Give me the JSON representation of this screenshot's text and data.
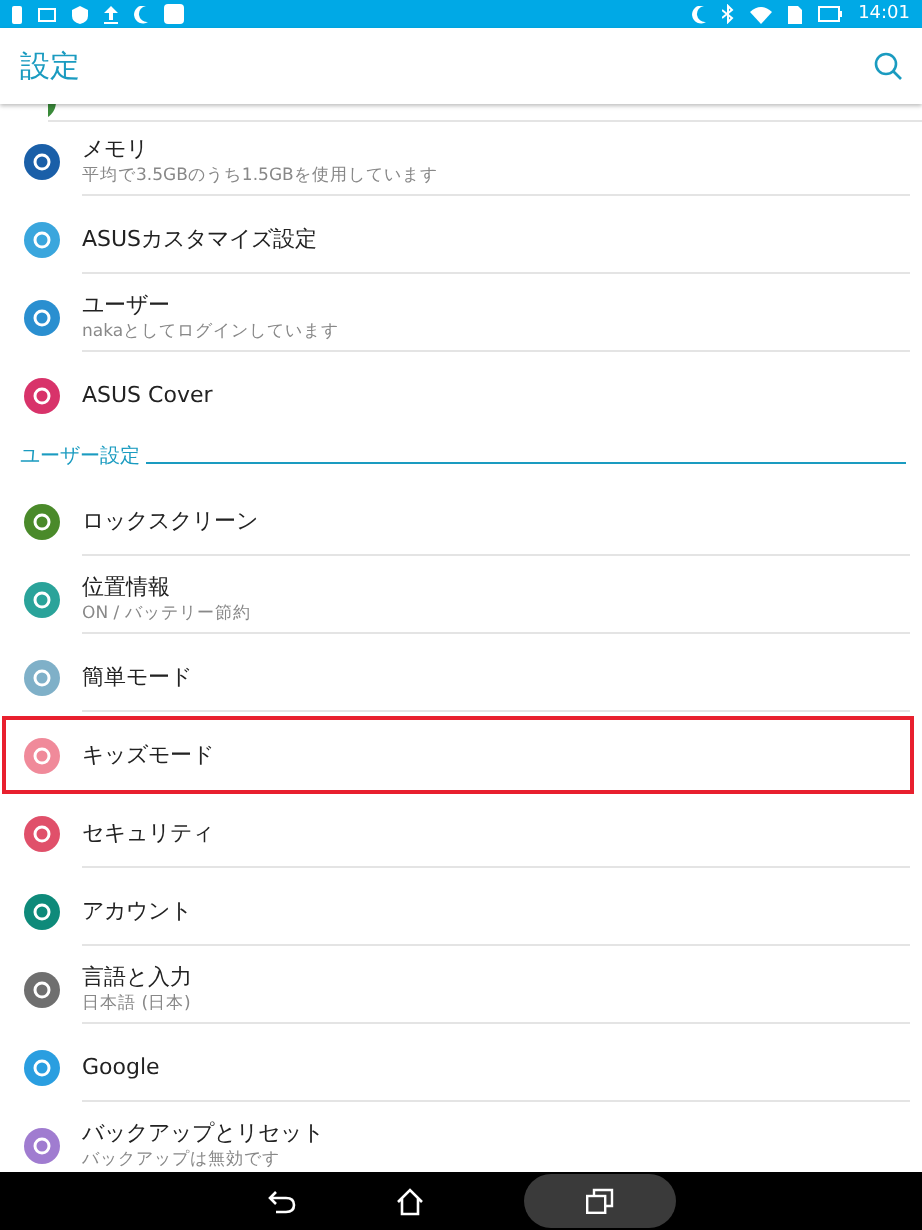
{
  "status_bar": {
    "time": "14:01"
  },
  "header": {
    "title": "設定"
  },
  "sections": [
    {
      "items": [
        {
          "title": "メモリ",
          "subtitle": "平均で3.5GBのうち1.5GBを使用しています",
          "color": "#1a5fa8",
          "highlighted": false
        },
        {
          "title": "ASUSカスタマイズ設定",
          "color": "#3aa6dd",
          "highlighted": false
        },
        {
          "title": "ユーザー",
          "subtitle": "nakaとしてログインしています",
          "color": "#2a8fd0",
          "highlighted": false
        },
        {
          "title": "ASUS Cover",
          "color": "#d8336a",
          "highlighted": false
        }
      ]
    },
    {
      "title": "ユーザー設定",
      "items": [
        {
          "title": "ロックスクリーン",
          "color": "#4a8a2a",
          "highlighted": false
        },
        {
          "title": "位置情報",
          "subtitle": "ON / バッテリー節約",
          "color": "#2aa39a",
          "highlighted": false
        },
        {
          "title": "簡単モード",
          "color": "#7fb0c8",
          "highlighted": false
        },
        {
          "title": "キッズモード",
          "color": "#f08a9a",
          "highlighted": true
        },
        {
          "title": "セキュリティ",
          "color": "#e0506a",
          "highlighted": false
        },
        {
          "title": "アカウント",
          "color": "#0e8a7a",
          "highlighted": false
        },
        {
          "title": "言語と入力",
          "subtitle": "日本語 (日本)",
          "color": "#6f6f6f",
          "highlighted": false
        },
        {
          "title": "Google",
          "color": "#2a9ee0",
          "highlighted": false
        },
        {
          "title": "バックアップとリセット",
          "subtitle": "バックアップは無効です",
          "color": "#a07cd0",
          "highlighted": false
        }
      ]
    }
  ]
}
